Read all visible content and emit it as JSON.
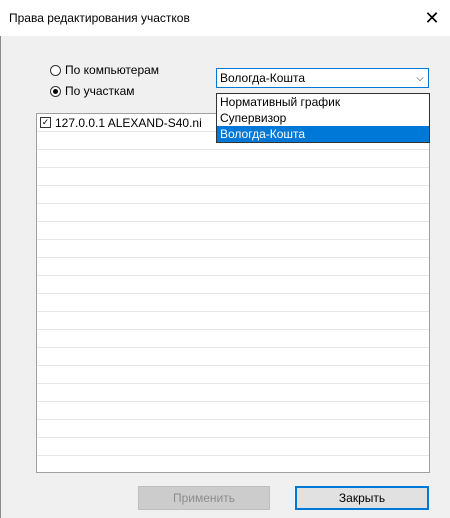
{
  "window": {
    "title": "Права редактирования участков"
  },
  "mode": {
    "options": [
      {
        "label": "По компьютерам",
        "checked": false
      },
      {
        "label": "По участкам",
        "checked": true
      }
    ]
  },
  "combo": {
    "value": "Вологда-Кошта",
    "options": [
      "Нормативный график",
      "Супервизор",
      "Вологда-Кошта"
    ],
    "selected_index": 2
  },
  "list": {
    "items": [
      {
        "label": "127.0.0.1 ALEXAND-S40.ni",
        "checked": true
      }
    ]
  },
  "buttons": {
    "apply": "Применить",
    "close": "Закрыть"
  },
  "colors": {
    "accent": "#0078d7"
  }
}
